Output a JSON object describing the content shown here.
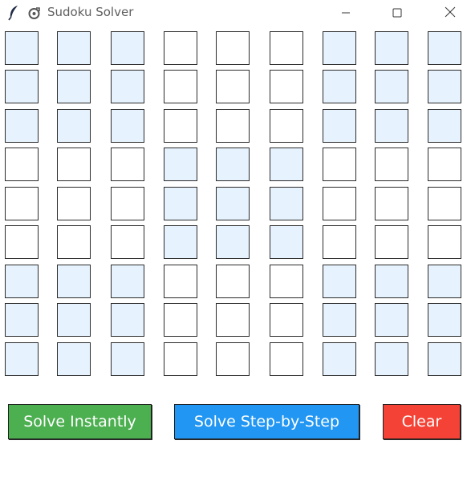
{
  "window": {
    "title": "Sudoku Solver",
    "icons": {
      "app": "feather-icon",
      "settings": "gear-icon",
      "minimize": "minimize-icon",
      "maximize": "maximize-icon",
      "close": "close-icon"
    }
  },
  "grid": {
    "rows": 9,
    "cols": 9,
    "values": [
      [
        "",
        "",
        "",
        "",
        "",
        "",
        "",
        "",
        ""
      ],
      [
        "",
        "",
        "",
        "",
        "",
        "",
        "",
        "",
        ""
      ],
      [
        "",
        "",
        "",
        "",
        "",
        "",
        "",
        "",
        ""
      ],
      [
        "",
        "",
        "",
        "",
        "",
        "",
        "",
        "",
        ""
      ],
      [
        "",
        "",
        "",
        "",
        "",
        "",
        "",
        "",
        ""
      ],
      [
        "",
        "",
        "",
        "",
        "",
        "",
        "",
        "",
        ""
      ],
      [
        "",
        "",
        "",
        "",
        "",
        "",
        "",
        "",
        ""
      ],
      [
        "",
        "",
        "",
        "",
        "",
        "",
        "",
        "",
        ""
      ],
      [
        "",
        "",
        "",
        "",
        "",
        "",
        "",
        "",
        ""
      ]
    ],
    "shaded_color": "#e6f2fd",
    "plain_color": "#ffffff"
  },
  "buttons": {
    "solve_instantly": "Solve Instantly",
    "solve_step": "Solve Step-by-Step",
    "clear": "Clear"
  },
  "colors": {
    "solve_instantly": "#4caf50",
    "solve_step": "#2196f3",
    "clear": "#f44336"
  }
}
